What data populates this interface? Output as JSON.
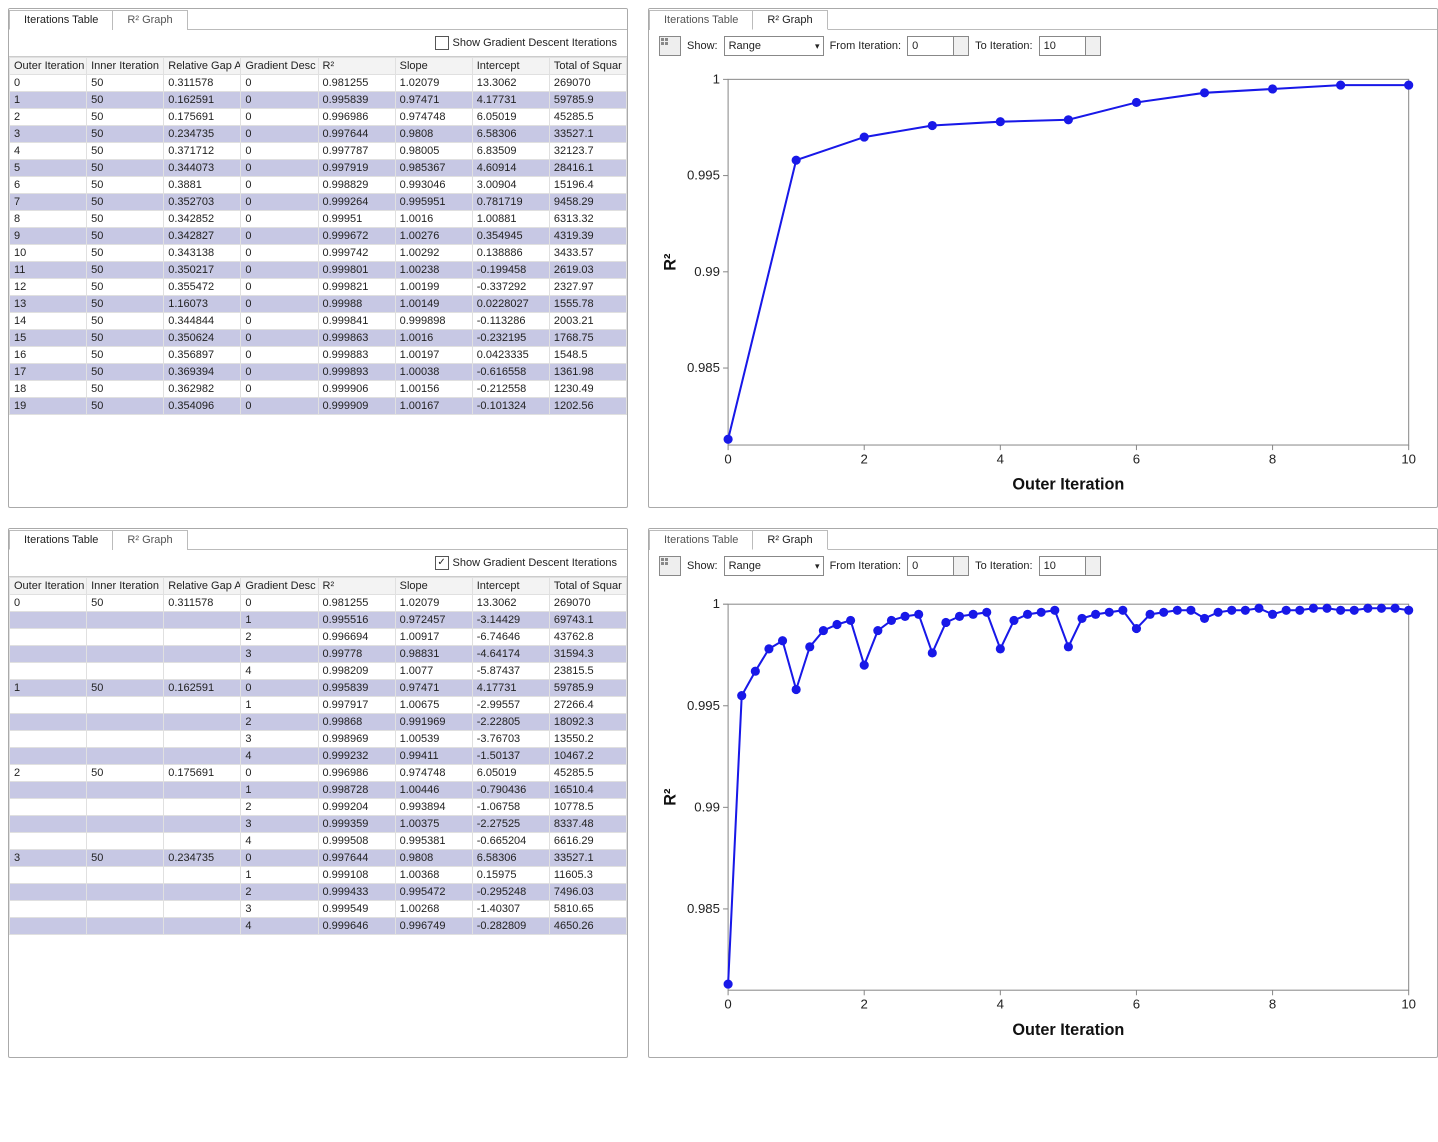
{
  "tabs": {
    "iter": "Iterations Table",
    "r2": "R² Graph"
  },
  "ck_label": "Show Gradient Descent Iterations",
  "table": {
    "headers": [
      "Outer Iteration",
      "Inner Iteration",
      "Relative Gap A",
      "Gradient Desc",
      "R²",
      "Slope",
      "Intercept",
      "Total of Squar"
    ],
    "rows_top": [
      [
        "0",
        "50",
        "0.311578",
        "0",
        "0.981255",
        "1.02079",
        "13.3062",
        "269070"
      ],
      [
        "1",
        "50",
        "0.162591",
        "0",
        "0.995839",
        "0.97471",
        "4.17731",
        "59785.9"
      ],
      [
        "2",
        "50",
        "0.175691",
        "0",
        "0.996986",
        "0.974748",
        "6.05019",
        "45285.5"
      ],
      [
        "3",
        "50",
        "0.234735",
        "0",
        "0.997644",
        "0.9808",
        "6.58306",
        "33527.1"
      ],
      [
        "4",
        "50",
        "0.371712",
        "0",
        "0.997787",
        "0.98005",
        "6.83509",
        "32123.7"
      ],
      [
        "5",
        "50",
        "0.344073",
        "0",
        "0.997919",
        "0.985367",
        "4.60914",
        "28416.1"
      ],
      [
        "6",
        "50",
        "0.3881",
        "0",
        "0.998829",
        "0.993046",
        "3.00904",
        "15196.4"
      ],
      [
        "7",
        "50",
        "0.352703",
        "0",
        "0.999264",
        "0.995951",
        "0.781719",
        "9458.29"
      ],
      [
        "8",
        "50",
        "0.342852",
        "0",
        "0.99951",
        "1.0016",
        "1.00881",
        "6313.32"
      ],
      [
        "9",
        "50",
        "0.342827",
        "0",
        "0.999672",
        "1.00276",
        "0.354945",
        "4319.39"
      ],
      [
        "10",
        "50",
        "0.343138",
        "0",
        "0.999742",
        "1.00292",
        "0.138886",
        "3433.57"
      ],
      [
        "11",
        "50",
        "0.350217",
        "0",
        "0.999801",
        "1.00238",
        "-0.199458",
        "2619.03"
      ],
      [
        "12",
        "50",
        "0.355472",
        "0",
        "0.999821",
        "1.00199",
        "-0.337292",
        "2327.97"
      ],
      [
        "13",
        "50",
        "1.16073",
        "0",
        "0.99988",
        "1.00149",
        "0.0228027",
        "1555.78"
      ],
      [
        "14",
        "50",
        "0.344844",
        "0",
        "0.999841",
        "0.999898",
        "-0.113286",
        "2003.21"
      ],
      [
        "15",
        "50",
        "0.350624",
        "0",
        "0.999863",
        "1.0016",
        "-0.232195",
        "1768.75"
      ],
      [
        "16",
        "50",
        "0.356897",
        "0",
        "0.999883",
        "1.00197",
        "0.0423335",
        "1548.5"
      ],
      [
        "17",
        "50",
        "0.369394",
        "0",
        "0.999893",
        "1.00038",
        "-0.616558",
        "1361.98"
      ],
      [
        "18",
        "50",
        "0.362982",
        "0",
        "0.999906",
        "1.00156",
        "-0.212558",
        "1230.49"
      ],
      [
        "19",
        "50",
        "0.354096",
        "0",
        "0.999909",
        "1.00167",
        "-0.101324",
        "1202.56"
      ]
    ],
    "rows_bottom": [
      {
        "outer": "0",
        "inner": "50",
        "gap": "0.311578",
        "sub": [
          [
            "0",
            "0.981255",
            "1.02079",
            "13.3062",
            "269070"
          ],
          [
            "1",
            "0.995516",
            "0.972457",
            "-3.14429",
            "69743.1"
          ],
          [
            "2",
            "0.996694",
            "1.00917",
            "-6.74646",
            "43762.8"
          ],
          [
            "3",
            "0.99778",
            "0.98831",
            "-4.64174",
            "31594.3"
          ],
          [
            "4",
            "0.998209",
            "1.0077",
            "-5.87437",
            "23815.5"
          ]
        ]
      },
      {
        "outer": "1",
        "inner": "50",
        "gap": "0.162591",
        "sub": [
          [
            "0",
            "0.995839",
            "0.97471",
            "4.17731",
            "59785.9"
          ],
          [
            "1",
            "0.997917",
            "1.00675",
            "-2.99557",
            "27266.4"
          ],
          [
            "2",
            "0.99868",
            "0.991969",
            "-2.22805",
            "18092.3"
          ],
          [
            "3",
            "0.998969",
            "1.00539",
            "-3.76703",
            "13550.2"
          ],
          [
            "4",
            "0.999232",
            "0.99411",
            "-1.50137",
            "10467.2"
          ]
        ]
      },
      {
        "outer": "2",
        "inner": "50",
        "gap": "0.175691",
        "sub": [
          [
            "0",
            "0.996986",
            "0.974748",
            "6.05019",
            "45285.5"
          ],
          [
            "1",
            "0.998728",
            "1.00446",
            "-0.790436",
            "16510.4"
          ],
          [
            "2",
            "0.999204",
            "0.993894",
            "-1.06758",
            "10778.5"
          ],
          [
            "3",
            "0.999359",
            "1.00375",
            "-2.27525",
            "8337.48"
          ],
          [
            "4",
            "0.999508",
            "0.995381",
            "-0.665204",
            "6616.29"
          ]
        ]
      },
      {
        "outer": "3",
        "inner": "50",
        "gap": "0.234735",
        "sub": [
          [
            "0",
            "0.997644",
            "0.9808",
            "6.58306",
            "33527.1"
          ],
          [
            "1",
            "0.999108",
            "1.00368",
            "0.15975",
            "11605.3"
          ],
          [
            "2",
            "0.999433",
            "0.995472",
            "-0.295248",
            "7496.03"
          ],
          [
            "3",
            "0.999549",
            "1.00268",
            "-1.40307",
            "5810.65"
          ],
          [
            "4",
            "0.999646",
            "0.996749",
            "-0.282809",
            "4650.26"
          ]
        ]
      }
    ]
  },
  "graph_ctrl": {
    "show": "Show:",
    "range": "Range",
    "from": "From Iteration:",
    "to": "To Iteration:",
    "from_v": "0",
    "to_v": "10"
  },
  "chart_data": [
    {
      "type": "line",
      "xlabel": "Outer Iteration",
      "ylabel": "R²",
      "x": [
        0,
        1,
        2,
        3,
        4,
        5,
        6,
        7,
        8,
        9,
        10
      ],
      "y": [
        0.9813,
        0.9958,
        0.997,
        0.9976,
        0.9978,
        0.9979,
        0.9988,
        0.9993,
        0.9995,
        0.9997,
        0.9997
      ],
      "xlim": [
        0,
        10
      ],
      "ylim": [
        0.981,
        1.0
      ],
      "yticks": [
        0.985,
        0.99,
        0.995,
        1
      ],
      "xticks": [
        0,
        2,
        4,
        6,
        8,
        10
      ]
    },
    {
      "type": "line",
      "xlabel": "Outer Iteration",
      "ylabel": "R²",
      "x": [
        0,
        0.2,
        0.4,
        0.6,
        0.8,
        1,
        1.2,
        1.4,
        1.6,
        1.8,
        2,
        2.2,
        2.4,
        2.6,
        2.8,
        3,
        3.2,
        3.4,
        3.6,
        3.8,
        4,
        4.2,
        4.4,
        4.6,
        4.8,
        5,
        5.2,
        5.4,
        5.6,
        5.8,
        6,
        6.2,
        6.4,
        6.6,
        6.8,
        7,
        7.2,
        7.4,
        7.6,
        7.8,
        8,
        8.2,
        8.4,
        8.6,
        8.8,
        9,
        9.2,
        9.4,
        9.6,
        9.8,
        10
      ],
      "y": [
        0.9813,
        0.9955,
        0.9967,
        0.9978,
        0.9982,
        0.9958,
        0.9979,
        0.9987,
        0.999,
        0.9992,
        0.997,
        0.9987,
        0.9992,
        0.9994,
        0.9995,
        0.9976,
        0.9991,
        0.9994,
        0.9995,
        0.9996,
        0.9978,
        0.9992,
        0.9995,
        0.9996,
        0.9997,
        0.9979,
        0.9993,
        0.9995,
        0.9996,
        0.9997,
        0.9988,
        0.9995,
        0.9996,
        0.9997,
        0.9997,
        0.9993,
        0.9996,
        0.9997,
        0.9997,
        0.9998,
        0.9995,
        0.9997,
        0.9997,
        0.9998,
        0.9998,
        0.9997,
        0.9997,
        0.9998,
        0.9998,
        0.9998,
        0.9997
      ],
      "xlim": [
        0,
        10
      ],
      "ylim": [
        0.981,
        1.0
      ],
      "yticks": [
        0.985,
        0.99,
        0.995,
        1
      ],
      "xticks": [
        0,
        2,
        4,
        6,
        8,
        10
      ]
    }
  ]
}
